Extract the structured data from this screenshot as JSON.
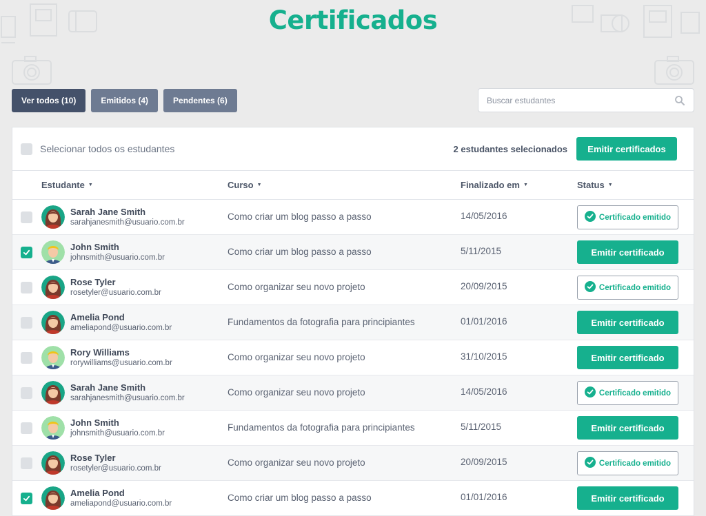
{
  "title": "Certificados",
  "filters": [
    {
      "label": "Ver todos (10)",
      "active": true
    },
    {
      "label": "Emitidos (4)",
      "active": false
    },
    {
      "label": "Pendentes (6)",
      "active": false
    }
  ],
  "search": {
    "placeholder": "Buscar estudantes"
  },
  "selection": {
    "select_all_label": "Selecionar todos os estudantes",
    "selected_count": "2 estudantes selecionados",
    "emit_all_label": "Emitir certificados"
  },
  "columns": {
    "student": "Estudante",
    "course": "Curso",
    "finished": "Finalizado em",
    "status": "Status"
  },
  "labels": {
    "emit": "Emitir certificado",
    "emitted": "Certificado emitido"
  },
  "colors": {
    "accent": "#16b08e",
    "filter_active": "#44516a",
    "filter": "#6e7b92"
  },
  "rows": [
    {
      "name": "Sarah Jane Smith",
      "email": "sarahjanesmith@usuario.com.br",
      "course": "Como criar um blog passo a passo",
      "date": "14/05/2016",
      "status": "emitted",
      "checked": false,
      "avatar": "female-avatar"
    },
    {
      "name": "John Smith",
      "email": "johnsmith@usuario.com.br",
      "course": "Como criar um blog passo a passo",
      "date": "5/11/2015",
      "status": "pending",
      "checked": true,
      "avatar": "male-avatar"
    },
    {
      "name": "Rose Tyler",
      "email": "rosetyler@usuario.com.br",
      "course": "Como organizar seu novo projeto",
      "date": "20/09/2015",
      "status": "emitted",
      "checked": false,
      "avatar": "female-avatar"
    },
    {
      "name": "Amelia Pond",
      "email": "ameliapond@usuario.com.br",
      "course": "Fundamentos da fotografia para principiantes",
      "date": "01/01/2016",
      "status": "pending",
      "checked": false,
      "avatar": "female-avatar"
    },
    {
      "name": "Rory Williams",
      "email": "rorywilliams@usuario.com.br",
      "course": "Como organizar seu novo projeto",
      "date": "31/10/2015",
      "status": "pending",
      "checked": false,
      "avatar": "male-avatar"
    },
    {
      "name": "Sarah Jane Smith",
      "email": "sarahjanesmith@usuario.com.br",
      "course": "Como organizar seu novo projeto",
      "date": "14/05/2016",
      "status": "emitted",
      "checked": false,
      "avatar": "female-avatar"
    },
    {
      "name": "John Smith",
      "email": "johnsmith@usuario.com.br",
      "course": "Fundamentos da fotografia para principiantes",
      "date": "5/11/2015",
      "status": "pending",
      "checked": false,
      "avatar": "male-avatar"
    },
    {
      "name": "Rose Tyler",
      "email": "rosetyler@usuario.com.br",
      "course": "Como organizar seu novo projeto",
      "date": "20/09/2015",
      "status": "emitted",
      "checked": false,
      "avatar": "female-avatar"
    },
    {
      "name": "Amelia Pond",
      "email": "ameliapond@usuario.com.br",
      "course": "Como criar um blog passo a passo",
      "date": "01/01/2016",
      "status": "pending",
      "checked": true,
      "avatar": "female-avatar"
    }
  ]
}
